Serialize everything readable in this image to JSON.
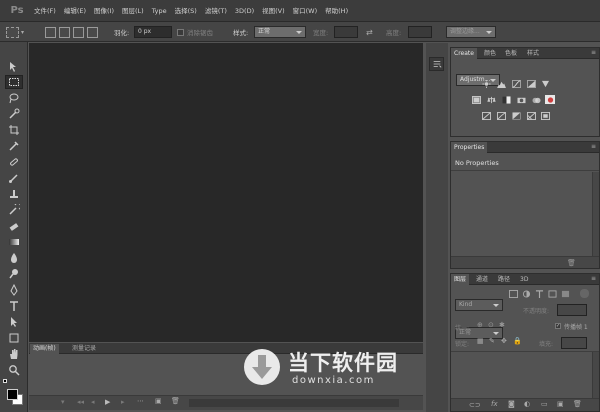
{
  "menu": [
    "文件(F)",
    "编辑(E)",
    "图像(I)",
    "图层(L)",
    "Type",
    "选择(S)",
    "滤镜(T)",
    "3D(D)",
    "视图(V)",
    "窗口(W)",
    "帮助(H)"
  ],
  "options": {
    "feather_label": "羽化:",
    "feather_value": "0 px",
    "antialias_label": "消除锯齿",
    "style_label": "样式:",
    "style_value": "正常",
    "width_label": "宽度:",
    "height_label": "高度:",
    "refine_button": "调整边缘..."
  },
  "panels": {
    "adjust": {
      "tabs": [
        "Create",
        "颜色",
        "色板",
        "样式"
      ],
      "dropdown": "Adjustm..."
    },
    "properties": {
      "tab": "Properties",
      "message": "No Properties"
    },
    "layers": {
      "tabs": [
        "图层",
        "通道",
        "路径",
        "3D"
      ],
      "filter_value": "Kind",
      "blend_mode": "正常",
      "opacity_label": "不透明度:",
      "unify_label": "统一:",
      "propagate_label": "传播帧 1",
      "lock_label": "锁定:",
      "fill_label": "填充:"
    }
  },
  "timeline": {
    "tabs": [
      "动画(帧)",
      "测量记录"
    ]
  },
  "watermark": {
    "title": "当下软件园",
    "url": "downxia.com"
  },
  "colors": {
    "menubar": "#3c3c3c",
    "canvas": "#282828",
    "panel": "#535353"
  }
}
